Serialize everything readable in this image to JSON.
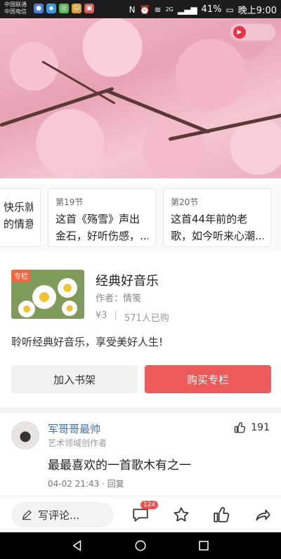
{
  "status_bar": {
    "carrier_1": "中国联通",
    "carrier_2": "中国电信",
    "signal_label": "2G",
    "battery": "41%",
    "time": "晚上9:00"
  },
  "episodes": [
    {
      "number": "",
      "title_line1": "快乐就",
      "title_line2": "的情意..."
    },
    {
      "number": "第19节",
      "title_line1": "这首《殇雪》声出",
      "title_line2": "金石，好听伤感，..."
    },
    {
      "number": "第20节",
      "title_line1": "这首44年前的老",
      "title_line2": "歌，如今听来心潮..."
    }
  ],
  "album": {
    "tag": "专栏",
    "title": "经典好音乐",
    "author": "作者：情笺",
    "price": "¥3",
    "purchases": "571人已购",
    "description": "聆听经典好音乐，享受美好人生!",
    "add_shelf_label": "加入书架",
    "buy_label": "购买专栏"
  },
  "comment": {
    "user_name": "军哥哥最帅",
    "user_role": "艺术领域创作者",
    "like_count": "191",
    "text": "最最喜欢的一首歌木有之一",
    "meta": "04-02 21:43 · 回复"
  },
  "action_bar": {
    "write_label": "写评论...",
    "comment_badge": "124"
  },
  "colors": {
    "buy_button": "#ec5a5a",
    "tag": "#f0693c",
    "user_name": "#4a6ea8",
    "badge": "#f24e4e"
  }
}
